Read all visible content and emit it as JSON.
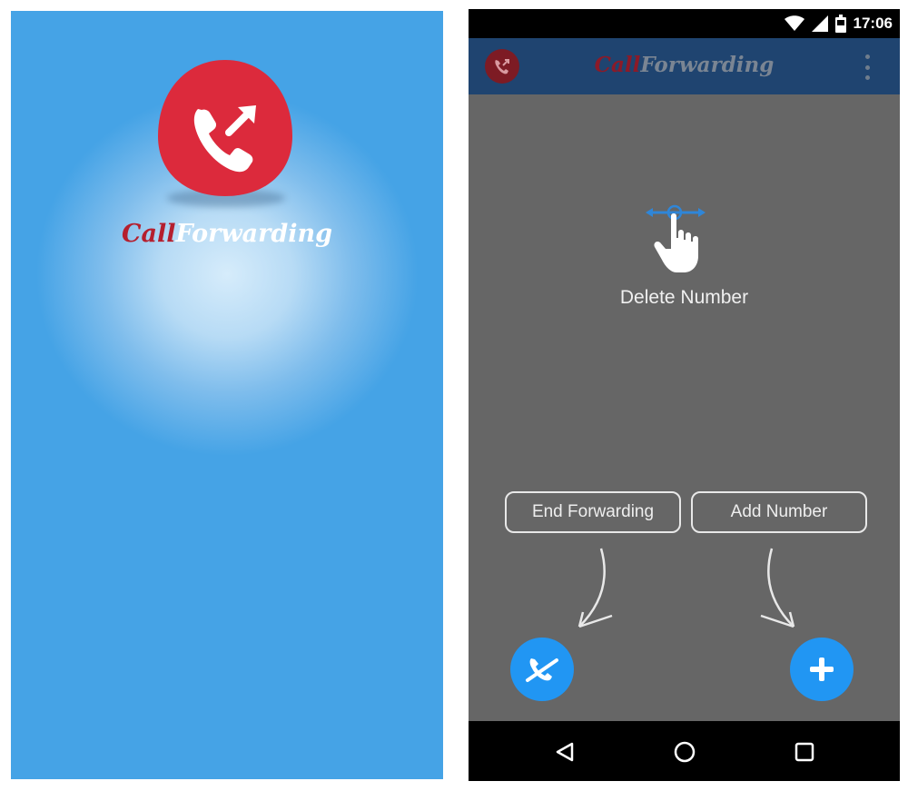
{
  "splash": {
    "title_part1": "Call",
    "title_part2": "Forwarding",
    "logo_icon": "phone-forward-icon",
    "colors": {
      "background": "#44a2e6",
      "logo_red": "#dc2a3c",
      "title_red": "#b51f2e"
    }
  },
  "status_bar": {
    "time": "17:06",
    "icons": [
      "wifi-icon",
      "signal-icon",
      "battery-icon"
    ]
  },
  "app_bar": {
    "title_part1": "Call",
    "title_part2": "Forwarding",
    "app_icon": "phone-forward-icon",
    "menu_icon": "overflow-menu-icon",
    "colors": {
      "background": "#1f4470"
    }
  },
  "tutorial": {
    "gesture_icon": "swipe-hand-icon",
    "delete_label": "Delete Number",
    "end_forwarding_label": "End Forwarding",
    "add_number_label": "Add Number"
  },
  "fabs": {
    "end_icon": "end-call-icon",
    "add_icon": "plus-icon",
    "colors": {
      "fab": "#2196f3"
    }
  },
  "nav_bar": {
    "icons": [
      "back-icon",
      "home-icon",
      "recents-icon"
    ]
  }
}
